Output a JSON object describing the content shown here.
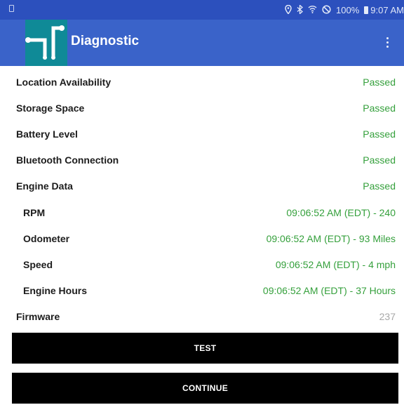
{
  "status_bar": {
    "icons": [
      "location-icon",
      "bluetooth-icon",
      "wifi-icon",
      "do-not-disturb-icon",
      "battery-icon"
    ],
    "battery": "100%",
    "time": "9:07 AM"
  },
  "app_bar": {
    "title": "Diagnostic",
    "menu_icon": "overflow-menu-icon"
  },
  "diagnostics": [
    {
      "label": "Location Availability",
      "value": "Passed"
    },
    {
      "label": "Storage Space",
      "value": "Passed"
    },
    {
      "label": "Battery Level",
      "value": "Passed"
    },
    {
      "label": "Bluetooth Connection",
      "value": "Passed"
    },
    {
      "label": "Engine Data",
      "value": "Passed"
    },
    {
      "label": "RPM",
      "value": "09:06:52 AM (EDT) - 240"
    },
    {
      "label": "Odometer",
      "value": "09:06:52 AM (EDT) - 93 Miles"
    },
    {
      "label": "Speed",
      "value": "09:06:52 AM (EDT) - 4 mph"
    },
    {
      "label": "Engine Hours",
      "value": "09:06:52 AM (EDT) - 37 Hours"
    },
    {
      "label": "Firmware",
      "value": "237"
    }
  ],
  "buttons": {
    "test": "TEST",
    "continue": "CONTINUE"
  },
  "colors": {
    "status_bar": "#2c50bd",
    "app_bar": "#3a63c9",
    "passed": "#35a03c",
    "muted": "#a8a8a8",
    "button": "#000000"
  }
}
